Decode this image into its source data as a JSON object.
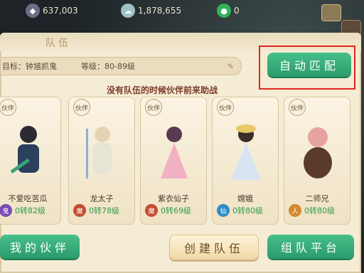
{
  "currencies": [
    {
      "icon": "silver-coin-icon",
      "value": "637,003"
    },
    {
      "icon": "cloud-coin-icon",
      "value": "1,878,655"
    },
    {
      "icon": "jade-icon",
      "value": "0"
    }
  ],
  "panel": {
    "title": "队伍",
    "target_label": "目标：钟馗抓鬼",
    "level_label": "等级：80-89级",
    "auto_match_label": "自动匹配",
    "hint": "没有队伍的时候伙伴前来助战"
  },
  "partners": [
    {
      "badge": "伙伴",
      "name": "不爱吃苦瓜",
      "school": "鬼",
      "level": "0转82级",
      "color": "#7a4bb2"
    },
    {
      "badge": "伙伴",
      "name": "龙太子",
      "school": "魔",
      "level": "0转78级",
      "color": "#c24d2f"
    },
    {
      "badge": "伙伴",
      "name": "紫衣仙子",
      "school": "魔",
      "level": "0转69级",
      "color": "#c24d2f"
    },
    {
      "badge": "伙伴",
      "name": "嫦娥",
      "school": "仙",
      "level": "0转80级",
      "color": "#2f8cc4"
    },
    {
      "badge": "伙伴",
      "name": "二师兄",
      "school": "人",
      "level": "0转80级",
      "color": "#d28a2f"
    }
  ],
  "buttons": {
    "my_partners": "我的伙伴",
    "create_team": "创建队伍",
    "team_platform": "组队平台"
  }
}
